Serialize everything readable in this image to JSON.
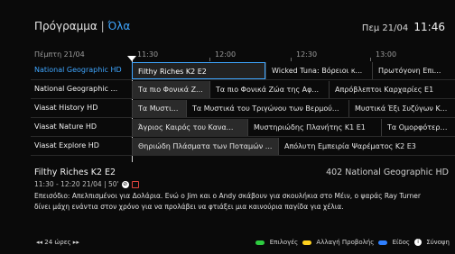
{
  "header": {
    "section": "Πρόγραμμα",
    "separator": "|",
    "filter": "Όλα",
    "date": "Πεμ 21/04",
    "time": "11:46"
  },
  "timeline": {
    "date": "Πέμπτη 21/04",
    "times": [
      "11:30",
      "12:00",
      "12:30",
      "13:00"
    ]
  },
  "channels": [
    {
      "name": "National Geographic HD",
      "active": true,
      "programs": [
        {
          "title": "Filthy Riches K2 E2",
          "selected": true
        },
        {
          "title": "Wicked Tuna: Βόρειοι κ..."
        },
        {
          "title": "Πρωτόγονη Επι..."
        }
      ]
    },
    {
      "name": "National Geographic ...",
      "programs": [
        {
          "title": "Τα πιο Φονικά Ζ..."
        },
        {
          "title": "Τα πιο Φονικά Ζώα της Αφ..."
        },
        {
          "title": "Απρόβλεπτοι Καρχαρίες E1"
        }
      ]
    },
    {
      "name": "Viasat History HD",
      "programs": [
        {
          "title": "Τα Μυστι..."
        },
        {
          "title": "Τα Μυστικά του Τριγώνου των Βερμού..."
        },
        {
          "title": "Μυστικά Έξι Συζύγων Κ..."
        }
      ]
    },
    {
      "name": "Viasat Nature HD",
      "programs": [
        {
          "title": "Άγριος Καιρός του Κανα..."
        },
        {
          "title": "Μυστηριώδης Πλανήτης K1 E1"
        },
        {
          "title": "Τα Ομορφότερα ..."
        }
      ]
    },
    {
      "name": "Viasat Explore HD",
      "programs": [
        {
          "title": "Θηριώδη Πλάσματα των Ποταμών ..."
        },
        {
          "title": "Απόλυτη Εμπειρία Ψαρέματος K2 E3"
        }
      ]
    }
  ],
  "details": {
    "title": "Filthy Riches K2 E2",
    "channel": "402 National Geographic HD",
    "time_range": "11:30 - 12:20 21/04 | 50'",
    "description": "Επεισόδιο: Απελπισμένοι για Δολάρια. Ενώ ο Jim και ο Andy σκάβουν για σκουλήκια στο Μέιν, ο ψαράς Ray Turner δίνει μάχη ενάντια στον χρόνο για να προλάβει να φτιάξει μια καινούρια παγίδα για χέλια."
  },
  "footer": {
    "hours": "◂◂ 24 ώρες ▸▸",
    "legend": [
      {
        "label": "Επιλογές",
        "color": "#2ecc40"
      },
      {
        "label": "Αλλαγή Προβολής",
        "color": "#ffd21f"
      },
      {
        "label": "Είδος",
        "color": "#2f80ff"
      },
      {
        "label": "Σύνοψη",
        "color": "#ffffff",
        "icon": "info-icon"
      }
    ]
  }
}
